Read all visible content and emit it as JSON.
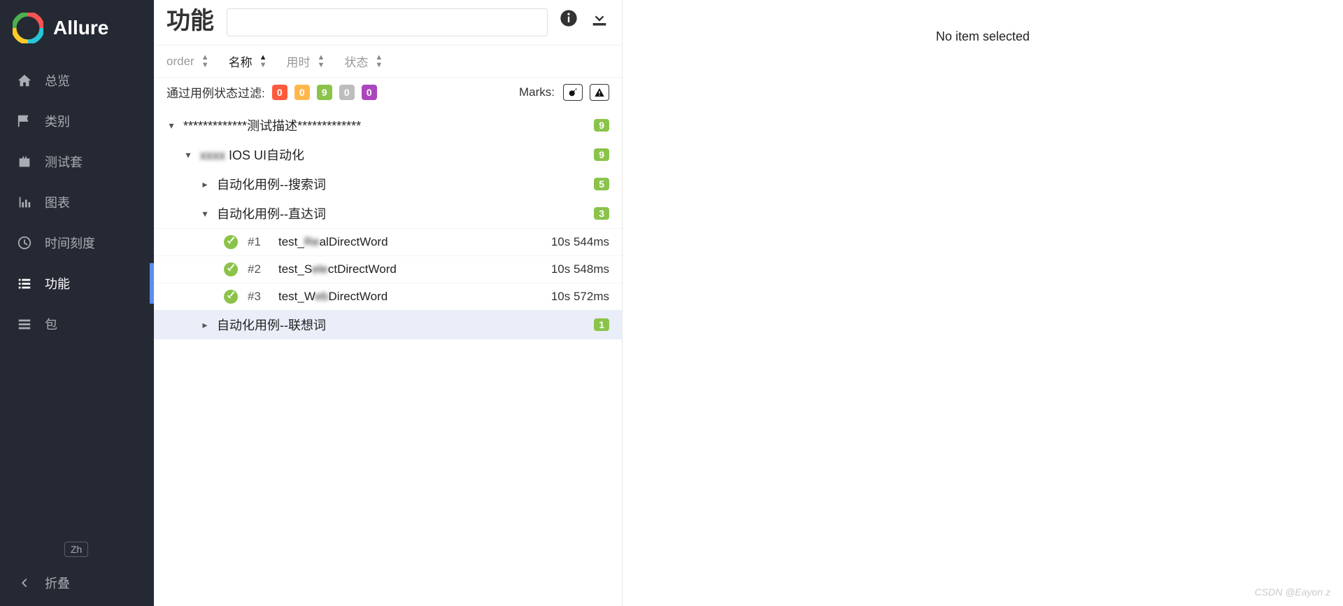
{
  "brand": {
    "name": "Allure"
  },
  "sidebar": {
    "items": [
      {
        "label": "总览",
        "icon": "home-icon"
      },
      {
        "label": "类别",
        "icon": "flag-icon"
      },
      {
        "label": "测试套",
        "icon": "briefcase-icon"
      },
      {
        "label": "图表",
        "icon": "chart-icon"
      },
      {
        "label": "时间刻度",
        "icon": "clock-icon"
      },
      {
        "label": "功能",
        "icon": "list-icon",
        "active": true
      },
      {
        "label": "包",
        "icon": "stack-icon"
      }
    ],
    "lang": "Zh",
    "collapse": "折叠"
  },
  "header": {
    "title": "功能",
    "search_placeholder": ""
  },
  "sorters": {
    "order": "order",
    "name": "名称",
    "duration": "用时",
    "status": "状态"
  },
  "filters": {
    "label": "通过用例状态过滤:",
    "counts": {
      "failed": "0",
      "broken": "0",
      "passed": "9",
      "skipped": "0",
      "unknown": "0"
    },
    "marks_label": "Marks:"
  },
  "tree": {
    "root": {
      "label": "*************测试描述*************",
      "count": "9"
    },
    "level1": {
      "label": "IOS UI自动化",
      "count": "9",
      "prefix_blur": "xxxx"
    },
    "groups": [
      {
        "label": "自动化用例--搜索词",
        "count": "5",
        "expanded": false
      },
      {
        "label": "自动化用例--直达词",
        "count": "3",
        "expanded": true,
        "tests": [
          {
            "id": "#1",
            "name_pre": "test_",
            "name_blur": "Re",
            "name_post": "alDirectWord",
            "time": "10s 544ms"
          },
          {
            "id": "#2",
            "name_pre": "test_S",
            "name_blur": "ele",
            "name_post": "ctDirectWord",
            "time": "10s 548ms"
          },
          {
            "id": "#3",
            "name_pre": "test_W",
            "name_blur": "eb",
            "name_post": "DirectWord",
            "time": "10s 572ms"
          }
        ]
      },
      {
        "label": "自动化用例--联想词",
        "count": "1",
        "expanded": false,
        "selected": true
      }
    ]
  },
  "right_panel": {
    "empty": "No item selected"
  },
  "watermark": "CSDN @Eayon z"
}
